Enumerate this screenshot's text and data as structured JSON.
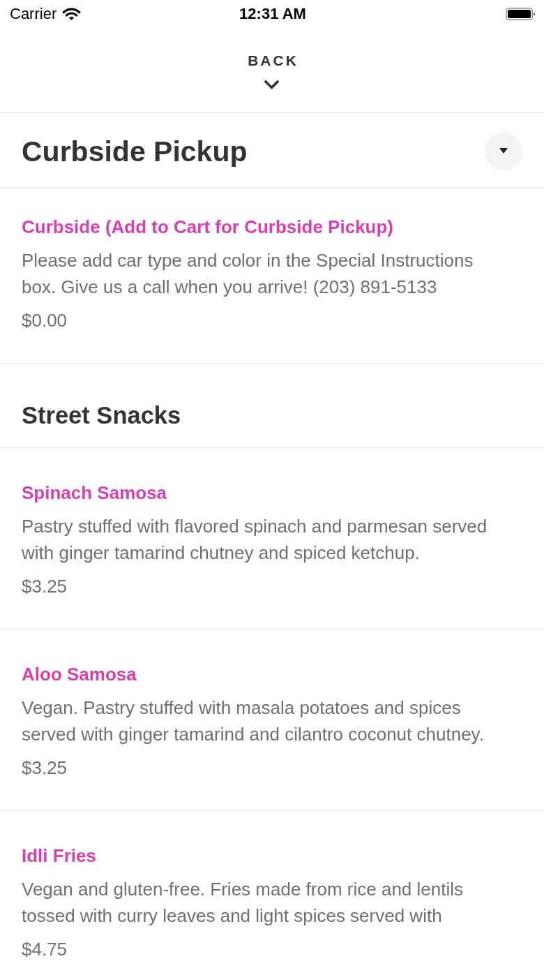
{
  "status_bar": {
    "carrier": "Carrier",
    "time": "12:31 AM"
  },
  "navigation": {
    "back_label": "BACK"
  },
  "sections": [
    {
      "kind": "dropdown",
      "title": "Curbside Pickup",
      "items": [
        {
          "name": "Curbside (Add to Cart for Curbside Pickup)",
          "description": "Please add car type and color in the Special Instructions box. Give us a call when you arrive! (203) 891-5133",
          "price": "$0.00"
        }
      ]
    },
    {
      "kind": "heading",
      "title": "Street Snacks",
      "items": [
        {
          "name": "Spinach Samosa",
          "description": "Pastry stuffed with flavored spinach and parmesan served with ginger tamarind chutney and spiced ketchup.",
          "price": "$3.25"
        },
        {
          "name": "Aloo Samosa",
          "description": "Vegan. Pastry stuffed with masala potatoes and spices served with ginger tamarind and cilantro coconut chutney.",
          "price": "$3.25"
        },
        {
          "name": "Idli Fries",
          "description": "Vegan and gluten-free. Fries made from rice and lentils tossed with curry leaves and light spices served with",
          "price": "$4.75"
        }
      ]
    }
  ]
}
